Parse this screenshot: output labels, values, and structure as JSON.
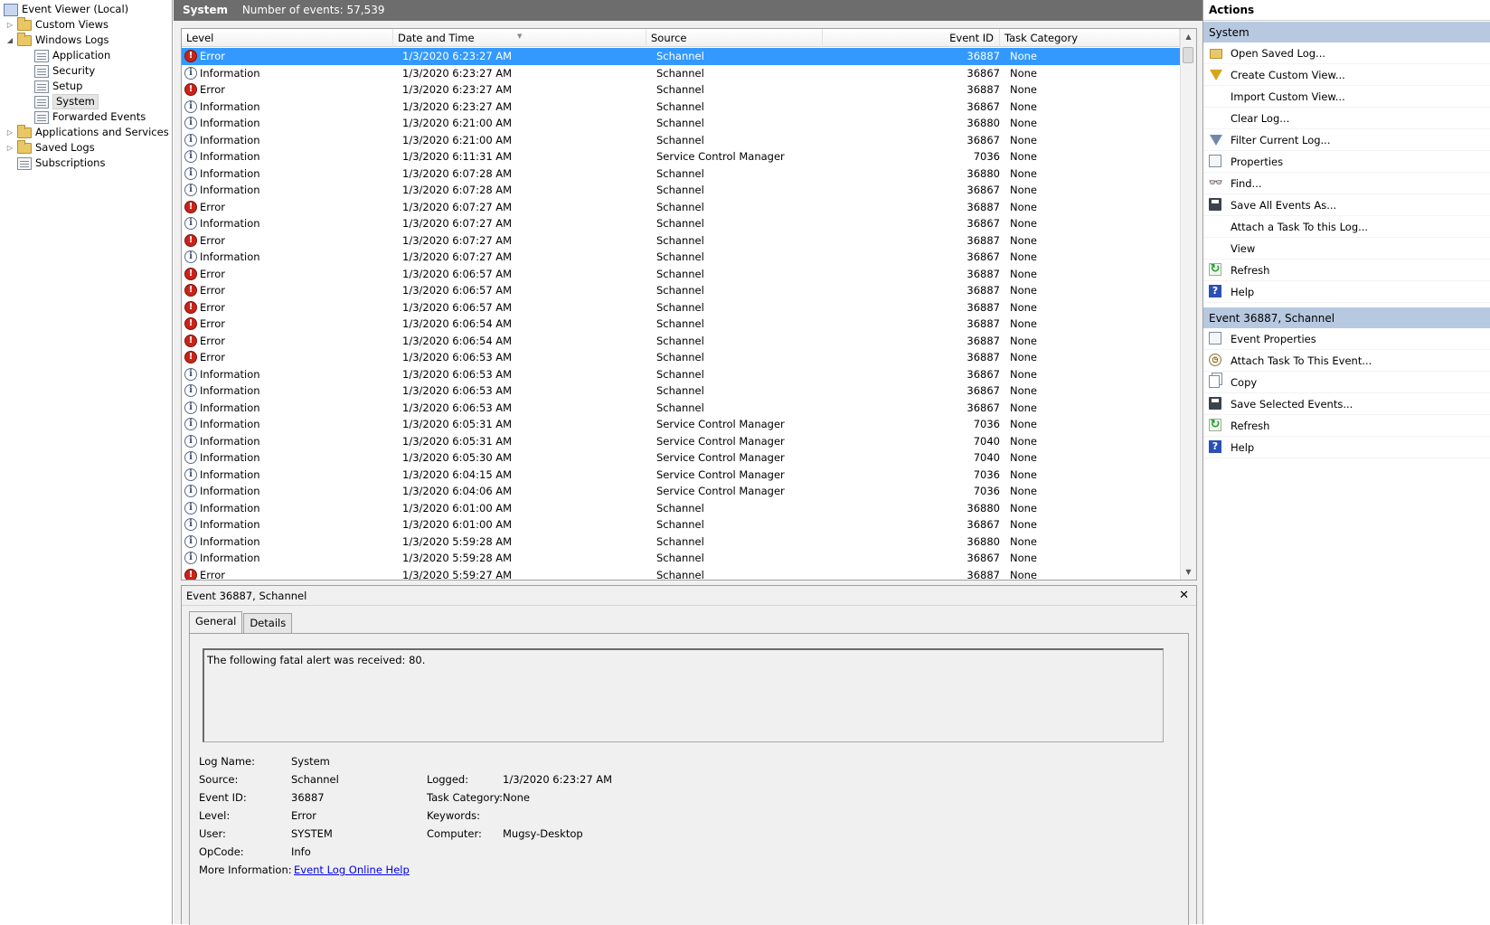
{
  "tree": {
    "root": "Event Viewer (Local)",
    "custom_views": "Custom Views",
    "windows_logs": "Windows Logs",
    "children": [
      "Application",
      "Security",
      "Setup",
      "System",
      "Forwarded Events"
    ],
    "apps_services": "Applications and Services Lo",
    "saved_logs": "Saved Logs",
    "subscriptions": "Subscriptions"
  },
  "header": {
    "title": "System",
    "count": "Number of events: 57,539"
  },
  "grid": {
    "columns": [
      "Level",
      "Date and Time",
      "Source",
      "Event ID",
      "Task Category"
    ],
    "rows": [
      [
        "Error",
        "1/3/2020 6:23:27 AM",
        "Schannel",
        "36887",
        "None"
      ],
      [
        "Information",
        "1/3/2020 6:23:27 AM",
        "Schannel",
        "36867",
        "None"
      ],
      [
        "Error",
        "1/3/2020 6:23:27 AM",
        "Schannel",
        "36887",
        "None"
      ],
      [
        "Information",
        "1/3/2020 6:23:27 AM",
        "Schannel",
        "36867",
        "None"
      ],
      [
        "Information",
        "1/3/2020 6:21:00 AM",
        "Schannel",
        "36880",
        "None"
      ],
      [
        "Information",
        "1/3/2020 6:21:00 AM",
        "Schannel",
        "36867",
        "None"
      ],
      [
        "Information",
        "1/3/2020 6:11:31 AM",
        "Service Control Manager",
        "7036",
        "None"
      ],
      [
        "Information",
        "1/3/2020 6:07:28 AM",
        "Schannel",
        "36880",
        "None"
      ],
      [
        "Information",
        "1/3/2020 6:07:28 AM",
        "Schannel",
        "36867",
        "None"
      ],
      [
        "Error",
        "1/3/2020 6:07:27 AM",
        "Schannel",
        "36887",
        "None"
      ],
      [
        "Information",
        "1/3/2020 6:07:27 AM",
        "Schannel",
        "36867",
        "None"
      ],
      [
        "Error",
        "1/3/2020 6:07:27 AM",
        "Schannel",
        "36887",
        "None"
      ],
      [
        "Information",
        "1/3/2020 6:07:27 AM",
        "Schannel",
        "36867",
        "None"
      ],
      [
        "Error",
        "1/3/2020 6:06:57 AM",
        "Schannel",
        "36887",
        "None"
      ],
      [
        "Error",
        "1/3/2020 6:06:57 AM",
        "Schannel",
        "36887",
        "None"
      ],
      [
        "Error",
        "1/3/2020 6:06:57 AM",
        "Schannel",
        "36887",
        "None"
      ],
      [
        "Error",
        "1/3/2020 6:06:54 AM",
        "Schannel",
        "36887",
        "None"
      ],
      [
        "Error",
        "1/3/2020 6:06:54 AM",
        "Schannel",
        "36887",
        "None"
      ],
      [
        "Error",
        "1/3/2020 6:06:53 AM",
        "Schannel",
        "36887",
        "None"
      ],
      [
        "Information",
        "1/3/2020 6:06:53 AM",
        "Schannel",
        "36867",
        "None"
      ],
      [
        "Information",
        "1/3/2020 6:06:53 AM",
        "Schannel",
        "36867",
        "None"
      ],
      [
        "Information",
        "1/3/2020 6:06:53 AM",
        "Schannel",
        "36867",
        "None"
      ],
      [
        "Information",
        "1/3/2020 6:05:31 AM",
        "Service Control Manager",
        "7036",
        "None"
      ],
      [
        "Information",
        "1/3/2020 6:05:31 AM",
        "Service Control Manager",
        "7040",
        "None"
      ],
      [
        "Information",
        "1/3/2020 6:05:30 AM",
        "Service Control Manager",
        "7040",
        "None"
      ],
      [
        "Information",
        "1/3/2020 6:04:15 AM",
        "Service Control Manager",
        "7036",
        "None"
      ],
      [
        "Information",
        "1/3/2020 6:04:06 AM",
        "Service Control Manager",
        "7036",
        "None"
      ],
      [
        "Information",
        "1/3/2020 6:01:00 AM",
        "Schannel",
        "36880",
        "None"
      ],
      [
        "Information",
        "1/3/2020 6:01:00 AM",
        "Schannel",
        "36867",
        "None"
      ],
      [
        "Information",
        "1/3/2020 5:59:28 AM",
        "Schannel",
        "36880",
        "None"
      ],
      [
        "Information",
        "1/3/2020 5:59:28 AM",
        "Schannel",
        "36867",
        "None"
      ],
      [
        "Error",
        "1/3/2020 5:59:27 AM",
        "Schannel",
        "36887",
        "None"
      ]
    ]
  },
  "detail": {
    "title": "Event 36887, Schannel",
    "close": "✕",
    "tabs": [
      "General",
      "Details"
    ],
    "description": "The following fatal alert was received: 80.",
    "log_name_label": "Log Name:",
    "log_name": "System",
    "source_label": "Source:",
    "source": "Schannel",
    "event_id_label": "Event ID:",
    "event_id": "36887",
    "level_label": "Level:",
    "level": "Error",
    "user_label": "User:",
    "user": "SYSTEM",
    "opcode_label": "OpCode:",
    "opcode": "Info",
    "more_info_label": "More Information:",
    "more_info_link": "Event Log Online Help",
    "logged_label": "Logged:",
    "logged": "1/3/2020 6:23:27 AM",
    "task_category_label": "Task Category:",
    "task_category": "None",
    "keywords_label": "Keywords:",
    "keywords": "",
    "computer_label": "Computer:",
    "computer": "Mugsy-Desktop"
  },
  "actions": {
    "title": "Actions",
    "section1": "System",
    "items1": [
      {
        "label": "Open Saved Log...",
        "icon": "folder-open-icon"
      },
      {
        "label": "Create Custom View...",
        "icon": "filter-icon"
      },
      {
        "label": "Import Custom View...",
        "icon": ""
      },
      {
        "label": "Clear Log...",
        "icon": ""
      },
      {
        "label": "Filter Current Log...",
        "icon": "filter-icon"
      },
      {
        "label": "Properties",
        "icon": "properties-icon"
      },
      {
        "label": "Find...",
        "icon": "binoculars-icon"
      },
      {
        "label": "Save All Events As...",
        "icon": "save-icon"
      },
      {
        "label": "Attach a Task To this Log...",
        "icon": ""
      },
      {
        "label": "View",
        "icon": ""
      },
      {
        "label": "Refresh",
        "icon": "refresh-icon"
      },
      {
        "label": "Help",
        "icon": "help-icon"
      }
    ],
    "section2": "Event 36887, Schannel",
    "items2": [
      {
        "label": "Event Properties",
        "icon": "properties-icon"
      },
      {
        "label": "Attach Task To This Event...",
        "icon": "task-icon"
      },
      {
        "label": "Copy",
        "icon": "copy-icon"
      },
      {
        "label": "Save Selected Events...",
        "icon": "save-icon"
      },
      {
        "label": "Refresh",
        "icon": "refresh-icon"
      },
      {
        "label": "Help",
        "icon": "help-icon"
      }
    ]
  }
}
